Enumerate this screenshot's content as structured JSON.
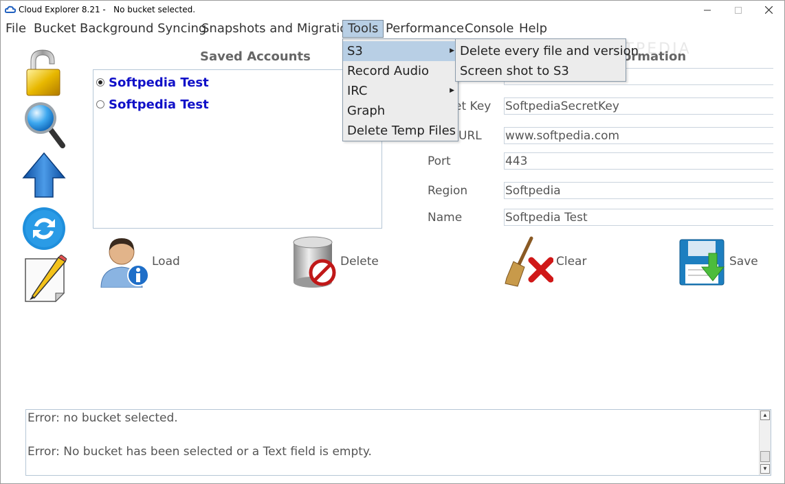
{
  "window": {
    "title": "Cloud Explorer 8.21 -   No bucket selected.",
    "minimize_icon": "minimize-icon",
    "maximize_icon": "maximize-icon",
    "close_icon": "close-icon"
  },
  "menubar": {
    "items": [
      {
        "label": "File"
      },
      {
        "label": "Bucket"
      },
      {
        "label": "Background Syncing"
      },
      {
        "label": "Snapshots and Migration"
      },
      {
        "label": "Tools",
        "active": true
      },
      {
        "label": "Performance"
      },
      {
        "label": "Console"
      },
      {
        "label": "Help"
      }
    ]
  },
  "tools_menu": {
    "items": [
      {
        "label": "S3",
        "submenu": true,
        "highlighted": true
      },
      {
        "label": "Record Audio"
      },
      {
        "label": "IRC",
        "submenu": true
      },
      {
        "label": "Graph"
      },
      {
        "label": "Delete Temp Files"
      }
    ]
  },
  "s3_submenu": {
    "items": [
      {
        "label": "Delete every file and version"
      },
      {
        "label": "Screen shot to S3"
      }
    ]
  },
  "toolbar": {
    "icons": [
      "unlock-icon",
      "search-icon",
      "upload-arrow-icon",
      "sync-icon",
      "edit-note-icon"
    ]
  },
  "saved_accounts": {
    "title": "Saved Accounts",
    "accounts": [
      {
        "name": "Softpedia Test",
        "selected": true
      },
      {
        "name": "Softpedia Test",
        "selected": false
      }
    ]
  },
  "account_info": {
    "title_visible": "nt Information",
    "fields": [
      {
        "label": "",
        "value": ""
      },
      {
        "label": "et Key",
        "value": "SoftpediaSecretKey"
      },
      {
        "label": "URL",
        "value": "www.softpedia.com"
      },
      {
        "label": "Port",
        "value": "443"
      },
      {
        "label": "Region",
        "value": "Softpedia"
      },
      {
        "label": "Name",
        "value": "Softpedia Test"
      }
    ]
  },
  "actions": {
    "load": "Load",
    "delete": "Delete",
    "clear": "Clear",
    "save": "Save"
  },
  "console": {
    "lines": [
      "Error: no bucket selected.",
      "Error: No bucket has been selected or a Text field is empty."
    ]
  },
  "watermark": "SOFTPEDIA",
  "colors": {
    "menu_highlight": "#b8cfe5",
    "account_name": "#1010c8",
    "border": "#b5c6d6"
  }
}
